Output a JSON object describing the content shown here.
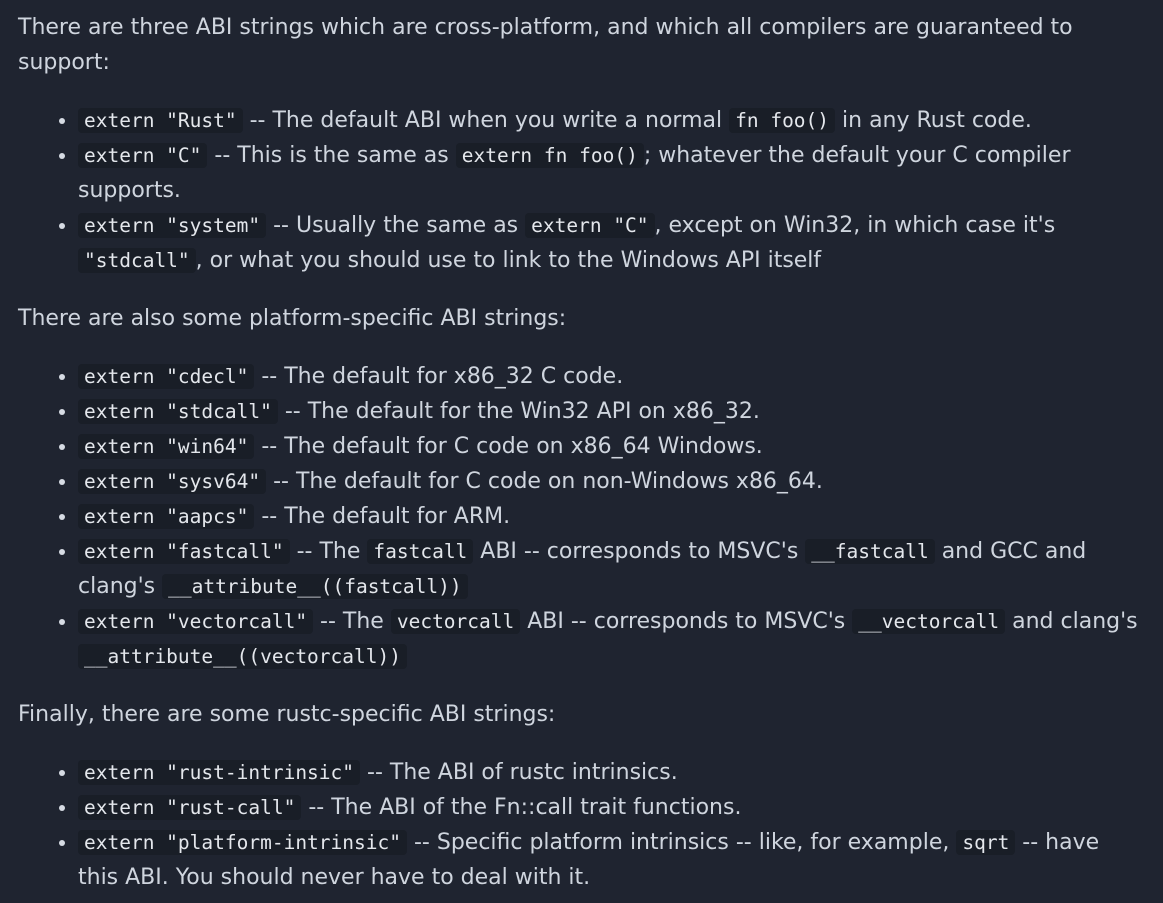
{
  "intro": "There are three ABI strings which are cross-platform, and which all compilers are guaranteed to support:",
  "cross_platform": [
    {
      "code": "extern \"Rust\"",
      "t1": " -- The default ABI when you write a normal ",
      "code2": "fn foo()",
      "t2": " in any Rust code."
    },
    {
      "code": "extern \"C\"",
      "t1": " -- This is the same as ",
      "code2": "extern fn foo()",
      "t2": "; whatever the default your C compiler supports."
    },
    {
      "code": "extern \"system\"",
      "t1": " -- Usually the same as ",
      "code2": "extern \"C\"",
      "t2": ", except on Win32, in which case it's ",
      "code3": "\"stdcall\"",
      "t3": ", or what you should use to link to the Windows API itself"
    }
  ],
  "platform_intro": "There are also some platform-specific ABI strings:",
  "platform_specific": [
    {
      "code": "extern \"cdecl\"",
      "t1": " -- The default for x86_32 C code."
    },
    {
      "code": "extern \"stdcall\"",
      "t1": " -- The default for the Win32 API on x86_32."
    },
    {
      "code": "extern \"win64\"",
      "t1": " -- The default for C code on x86_64 Windows."
    },
    {
      "code": "extern \"sysv64\"",
      "t1": " -- The default for C code on non-Windows x86_64."
    },
    {
      "code": "extern \"aapcs\"",
      "t1": " -- The default for ARM."
    },
    {
      "code": "extern \"fastcall\"",
      "t1": " -- The ",
      "code2": "fastcall",
      "t2": " ABI -- corresponds to MSVC's ",
      "code3": "__fastcall",
      "t3": " and GCC and clang's ",
      "code4": "__attribute__((fastcall))"
    },
    {
      "code": "extern \"vectorcall\"",
      "t1": " -- The ",
      "code2": "vectorcall",
      "t2": " ABI -- corresponds to MSVC's ",
      "code3": "__vectorcall",
      "t3": " and clang's ",
      "code4": "__attribute__((vectorcall))"
    }
  ],
  "rustc_intro": "Finally, there are some rustc-specific ABI strings:",
  "rustc_specific": [
    {
      "code": "extern \"rust-intrinsic\"",
      "t1": " -- The ABI of rustc intrinsics."
    },
    {
      "code": "extern \"rust-call\"",
      "t1": " -- The ABI of the Fn::call trait functions."
    },
    {
      "code": "extern \"platform-intrinsic\"",
      "t1": " -- Specific platform intrinsics -- like, for example, ",
      "code2": "sqrt",
      "t2": " -- have this ABI. You should never have to deal with it."
    }
  ]
}
